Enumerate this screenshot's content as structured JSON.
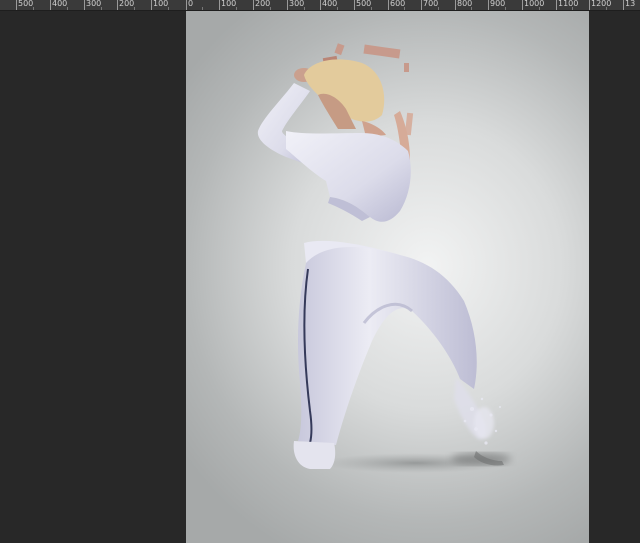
{
  "ruler": {
    "left_labels": [
      "500",
      "400",
      "300",
      "200",
      "100"
    ],
    "right_labels": [
      "0",
      "100",
      "200",
      "300",
      "400",
      "500",
      "600",
      "700",
      "800",
      "900",
      "1000",
      "1100",
      "1200",
      "13"
    ]
  },
  "colors": {
    "workspace": "#282828",
    "ruler": "#3a3a3a",
    "canvas_center": "#f2f3f3",
    "canvas_edge": "#a6a9a9",
    "clothing": "#e4e4ef",
    "clothing_shadow": "#a9a9c4",
    "hair": "#e2c89a",
    "skin": "#d9a792"
  },
  "canvas": {
    "subject": "dancer-photo"
  }
}
